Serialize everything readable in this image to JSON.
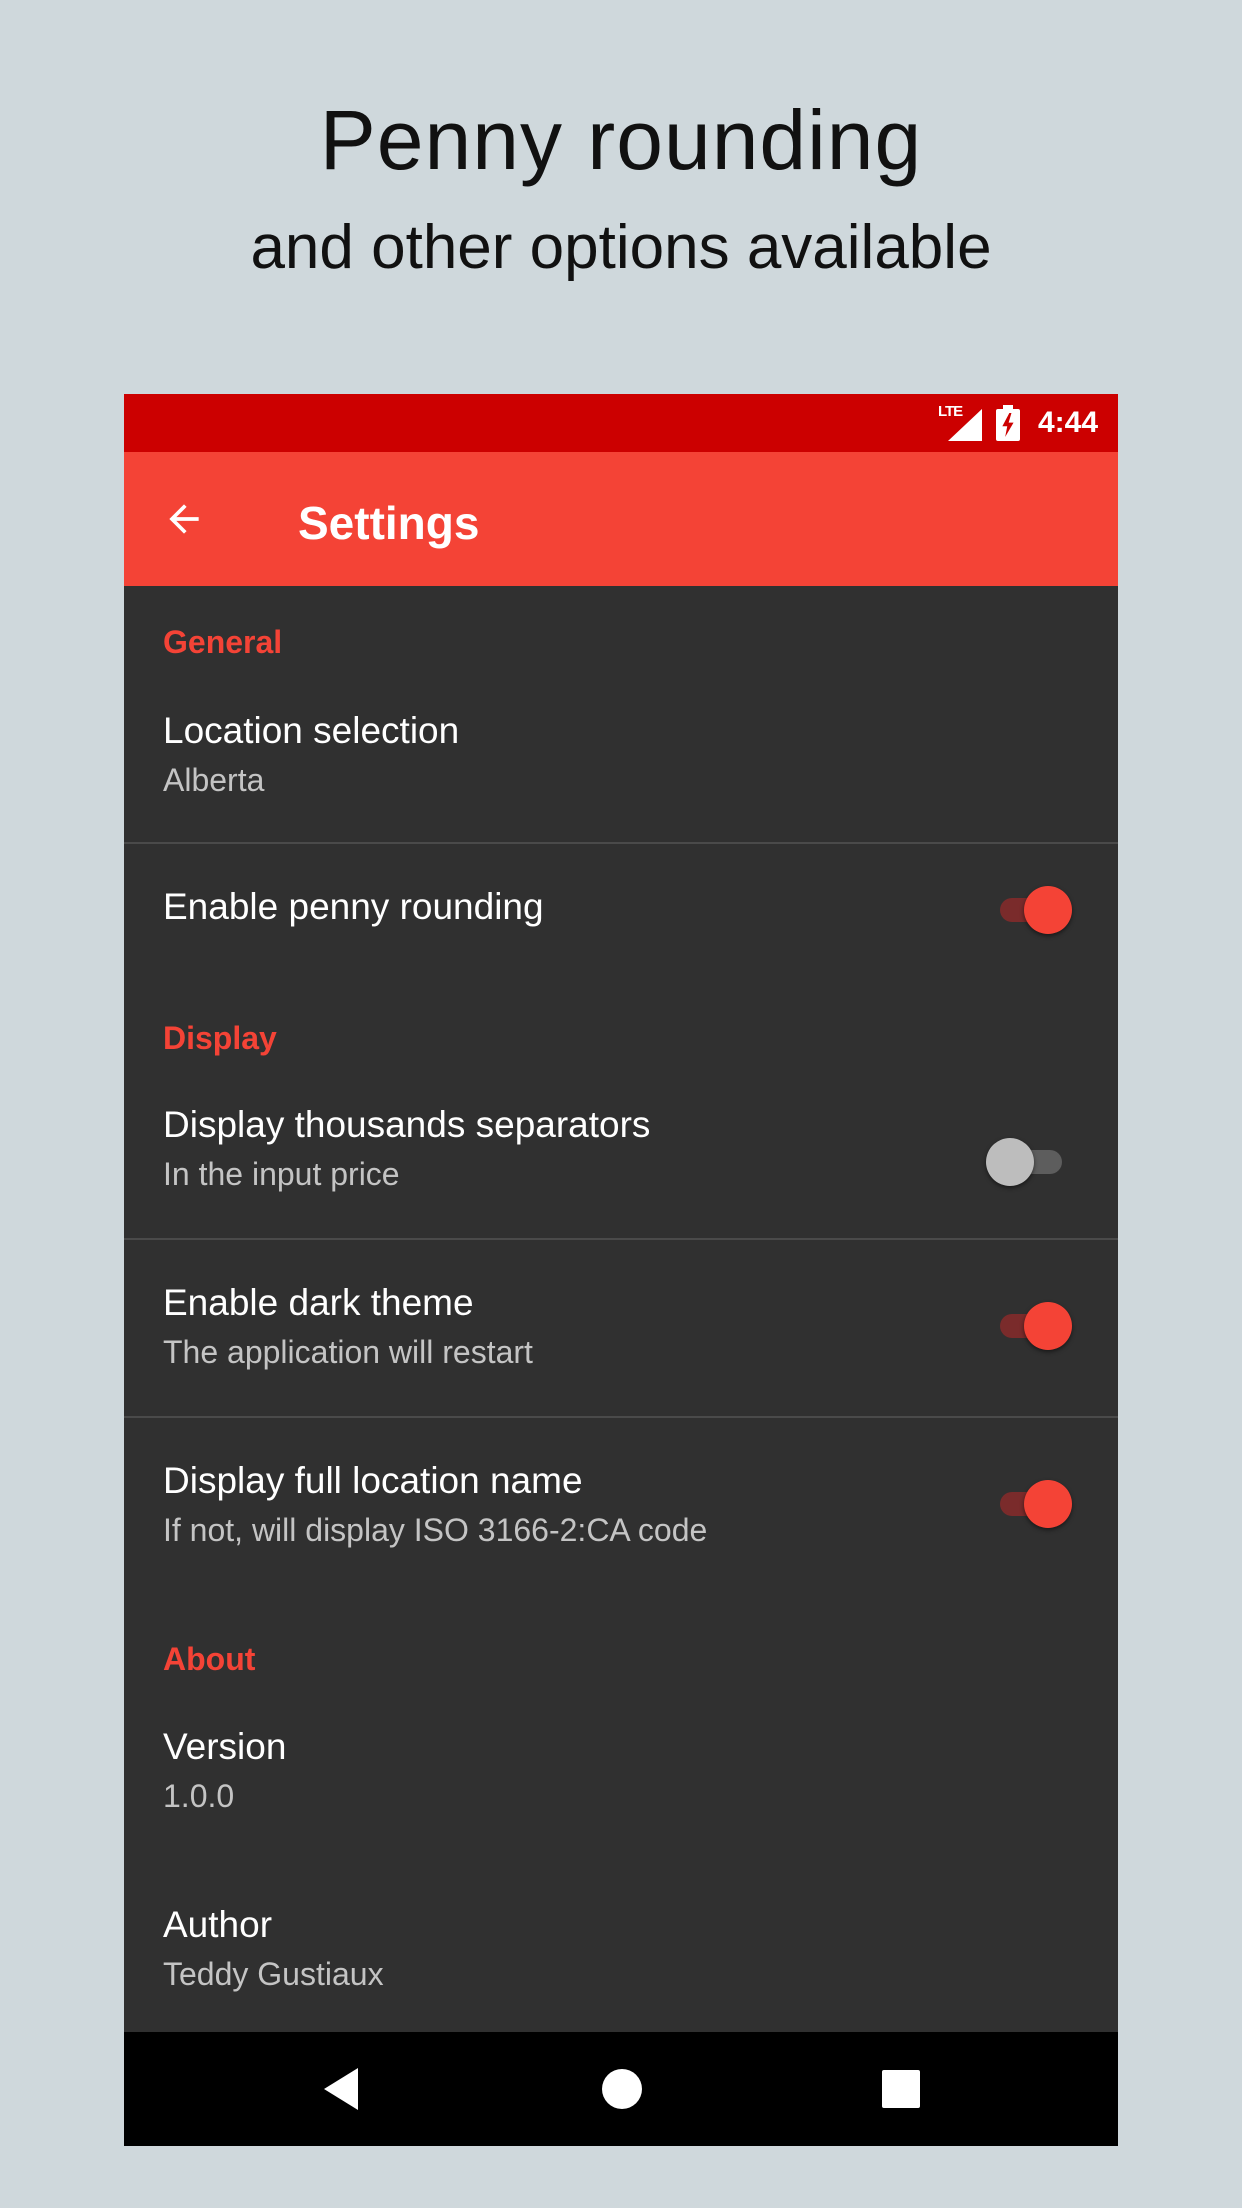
{
  "promo": {
    "title": "Penny rounding",
    "subtitle": "and other options available"
  },
  "status_bar": {
    "network": "LTE",
    "time": "4:44",
    "icons": [
      "signal-icon",
      "battery-charging-icon"
    ]
  },
  "app_bar": {
    "back_icon": "arrow-left-icon",
    "title": "Settings"
  },
  "sections": {
    "general": "General",
    "display": "Display",
    "about": "About"
  },
  "settings": {
    "location": {
      "title": "Location selection",
      "summary": "Alberta"
    },
    "penny": {
      "title": "Enable penny rounding",
      "enabled": true
    },
    "thousands": {
      "title": "Display thousands separators",
      "summary": "In the input price",
      "enabled": false
    },
    "dark": {
      "title": "Enable dark theme",
      "summary": "The application will restart",
      "enabled": true
    },
    "fullname": {
      "title": "Display full location name",
      "summary": "If not, will display ISO 3166-2:CA code",
      "enabled": true
    },
    "version": {
      "title": "Version",
      "summary": "1.0.0"
    },
    "author": {
      "title": "Author",
      "summary": "Teddy Gustiaux"
    }
  },
  "colors": {
    "accent": "#f44336",
    "status_bar": "#cc0000",
    "background": "#303030",
    "page": "#cfd8dc"
  }
}
